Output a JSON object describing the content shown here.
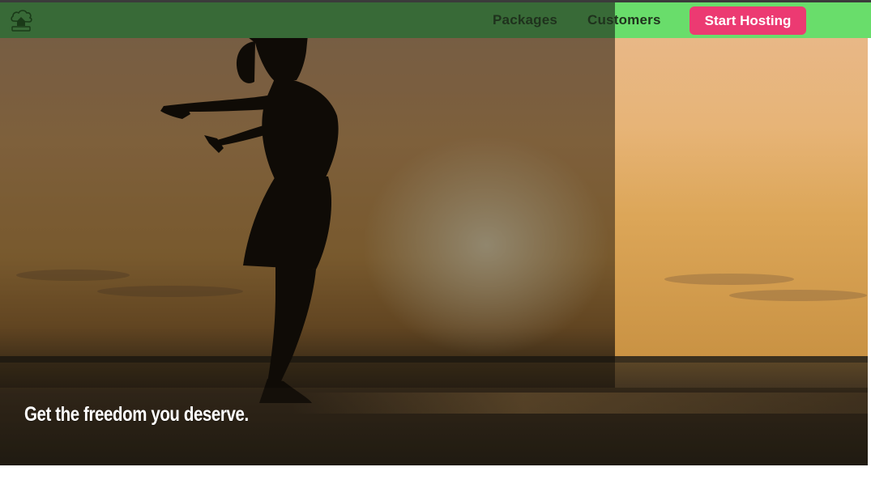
{
  "nav": {
    "logo_icon": "cloud-house-icon",
    "links": [
      {
        "label": "Packages"
      },
      {
        "label": "Customers"
      }
    ],
    "cta_label": "Start Hosting"
  },
  "hero": {
    "tagline": "Get the freedom you deserve."
  },
  "colors": {
    "nav_dark": "#386a37",
    "nav_light": "#69dd6b",
    "cta": "#ec3a72"
  }
}
